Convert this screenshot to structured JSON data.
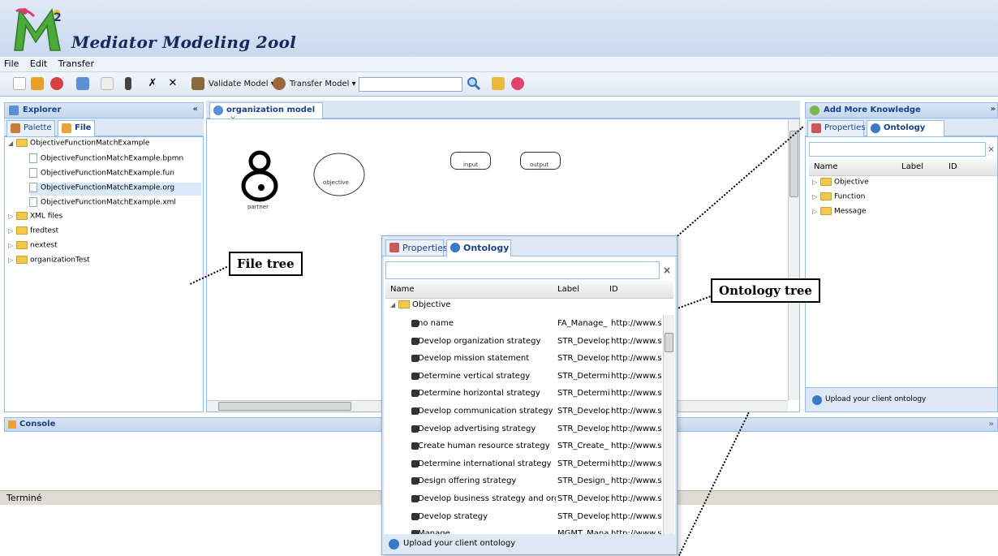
{
  "app": {
    "title": "Mediator Modeling 2ool",
    "logo_letter": "M",
    "logo_sup": "2"
  },
  "menu": [
    "File",
    "Edit",
    "Transfer"
  ],
  "toolbar": {
    "validate_label": "Validate Model",
    "transfer_label": "Transfer Model",
    "search_value": "",
    "dropdown_glyph": "▾"
  },
  "explorer": {
    "title": "Explorer",
    "collapse_glyph": "«",
    "tabs": [
      "Palette",
      "File"
    ],
    "root": "ObjectiveFunctionMatchExample",
    "files": [
      "ObjectiveFunctionMatchExample.bpmn",
      "ObjectiveFunctionMatchExample.fun",
      "ObjectiveFunctionMatchExample.org",
      "ObjectiveFunctionMatchExample.xml"
    ],
    "folders": [
      "XML files",
      "fredtest",
      "nextest",
      "organizationTest"
    ]
  },
  "editor": {
    "tab_label": "organization model",
    "tab_close": "×",
    "shapes": {
      "partner": "partner",
      "objective": "objective",
      "input": "input",
      "output": "output"
    }
  },
  "knowledge": {
    "title": "Add More Knowledge",
    "expand_glyph": "»",
    "tabs": [
      "Properties",
      "Ontology"
    ],
    "columns": [
      "Name",
      "Label",
      "ID"
    ],
    "nodes": [
      "Objective",
      "Function",
      "Message"
    ],
    "clear_glyph": "×",
    "upload": "Upload your client ontology"
  },
  "callouts": {
    "file_tree": "File tree",
    "ontology_tree": "Ontology tree"
  },
  "popup": {
    "tabs": [
      "Properties",
      "Ontology"
    ],
    "clear_glyph": "×",
    "columns": [
      "Name",
      "Label",
      "ID"
    ],
    "root": "Objective",
    "rows": [
      {
        "name": "no name",
        "label": "FA_Manage_",
        "id": "http://www.s"
      },
      {
        "name": "Develop organization strategy",
        "label": "STR_Develop",
        "id": "http://www.s"
      },
      {
        "name": "Develop mission statement",
        "label": "STR_Develop",
        "id": "http://www.s"
      },
      {
        "name": "Determine vertical strategy",
        "label": "STR_Determi",
        "id": "http://www.s"
      },
      {
        "name": "Determine horizontal strategy",
        "label": "STR_Determi",
        "id": "http://www.s"
      },
      {
        "name": "Develop communication strategy",
        "label": "STR_Develop",
        "id": "http://www.s"
      },
      {
        "name": "Develop advertising strategy",
        "label": "STR_Develop",
        "id": "http://www.s"
      },
      {
        "name": "Create human resource strategy",
        "label": "STR_Create_",
        "id": "http://www.s"
      },
      {
        "name": "Determine international strategy",
        "label": "STR_Determi",
        "id": "http://www.s"
      },
      {
        "name": "Design offering strategy",
        "label": "STR_Design_",
        "id": "http://www.s"
      },
      {
        "name": "Develop business strategy and org",
        "label": "STR_Develop",
        "id": "http://www.s"
      },
      {
        "name": "Develop strategy",
        "label": "STR_Develop",
        "id": "http://www.s"
      },
      {
        "name": "Manage",
        "label": "MGMT_Mana",
        "id": "http://www.s"
      }
    ],
    "upload": "Upload your client ontology"
  },
  "console": {
    "title": "Console",
    "expand_glyph": "»"
  },
  "status": {
    "text": "Terminé"
  }
}
